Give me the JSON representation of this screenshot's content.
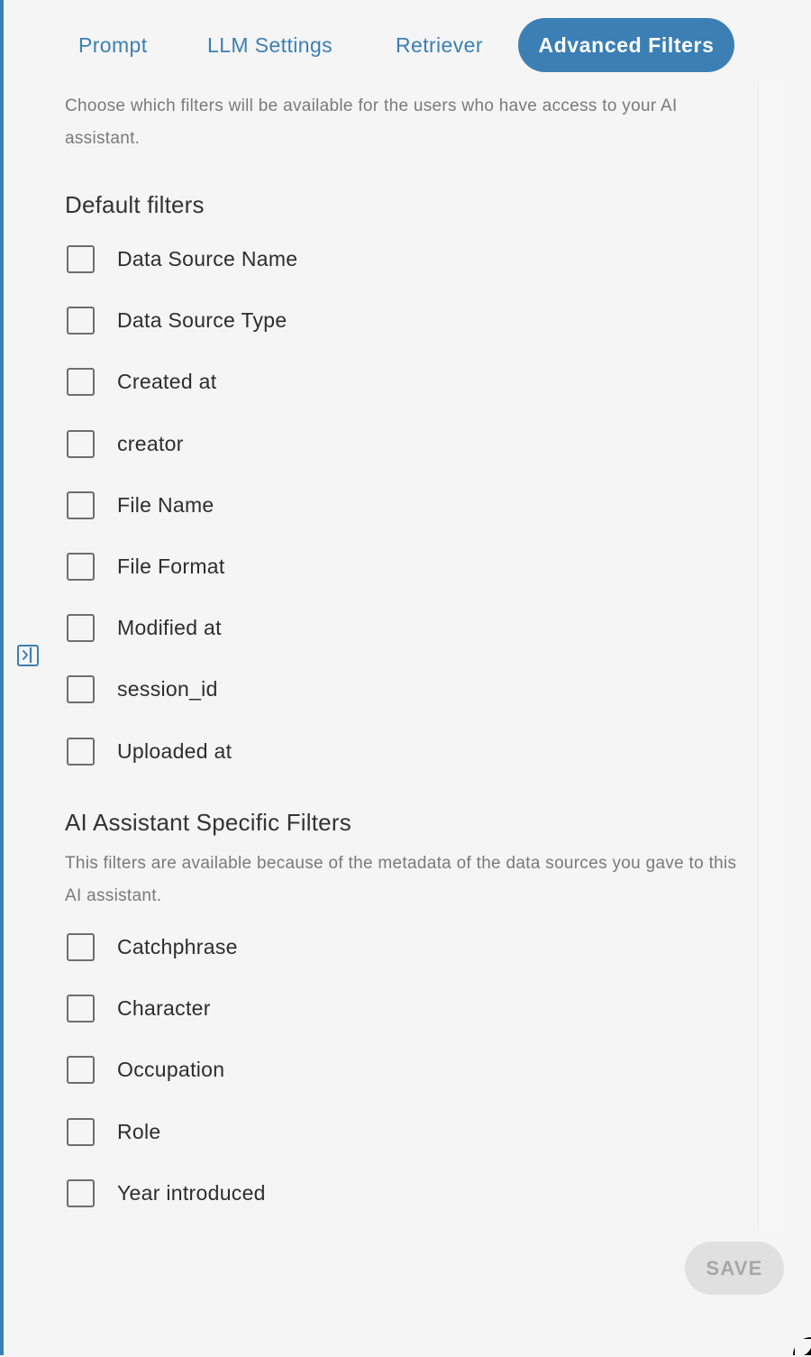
{
  "tabs": [
    {
      "label": "Prompt",
      "active": false
    },
    {
      "label": "LLM Settings",
      "active": false
    },
    {
      "label": "Retriever",
      "active": false
    },
    {
      "label": "Advanced Filters",
      "active": true
    }
  ],
  "intro": "Choose which filters will be available for the users who have access to your AI assistant.",
  "default_filters": {
    "title": "Default filters",
    "options": [
      {
        "label": "Data Source Name",
        "checked": false
      },
      {
        "label": "Data Source Type",
        "checked": false
      },
      {
        "label": "Created at",
        "checked": false
      },
      {
        "label": "creator",
        "checked": false
      },
      {
        "label": "File Name",
        "checked": false
      },
      {
        "label": "File Format",
        "checked": false
      },
      {
        "label": "Modified at",
        "checked": false
      },
      {
        "label": "session_id",
        "checked": false
      },
      {
        "label": "Uploaded at",
        "checked": false
      }
    ]
  },
  "specific_filters": {
    "title": "AI Assistant Specific Filters",
    "description": "This filters are available because of the metadata of the data sources you gave to this AI assistant.",
    "options": [
      {
        "label": "Catchphrase",
        "checked": false
      },
      {
        "label": "Character",
        "checked": false
      },
      {
        "label": "Occupation",
        "checked": false
      },
      {
        "label": "Role",
        "checked": false
      },
      {
        "label": "Year introduced",
        "checked": false
      }
    ]
  },
  "save_label": "SAVE",
  "icons": {
    "collapse": "panel-expand-icon",
    "checkbox": "checkbox-unchecked-icon"
  },
  "colors": {
    "accent": "#3b7fb5",
    "save_disabled_bg": "#e0e0e0",
    "save_disabled_text": "#a7a7a7"
  }
}
